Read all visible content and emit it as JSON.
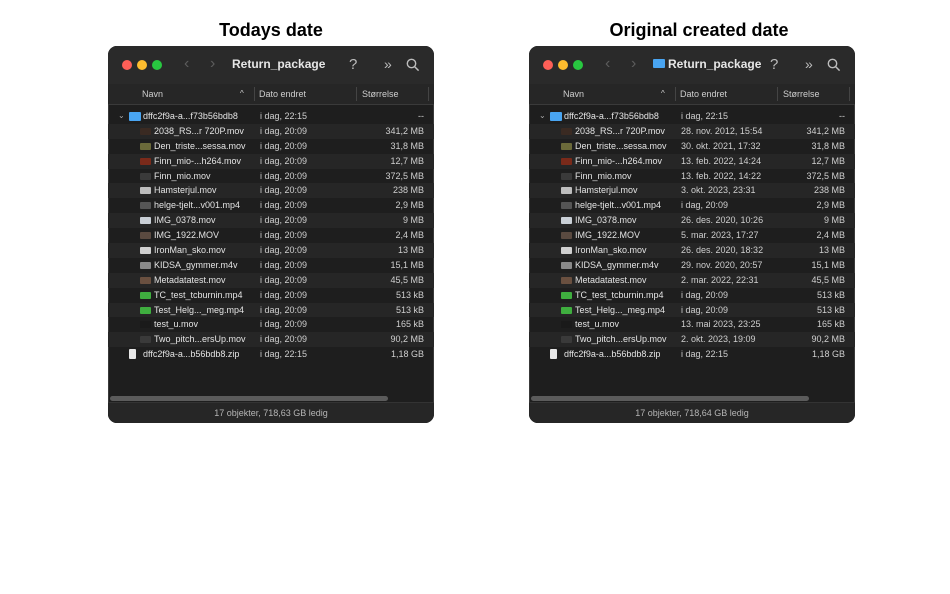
{
  "panels": [
    {
      "heading": "Todays date",
      "window": {
        "title": "Return_package",
        "columns": {
          "name": "Navn",
          "date": "Dato endret",
          "size": "Størrelse"
        },
        "rows": [
          {
            "name": "dffc2f9a-a...f73b56bdb8",
            "date": "i dag, 22:15",
            "size": "--"
          },
          {
            "name": "2038_RS...r 720P.mov",
            "date": "i dag, 20:09",
            "size": "341,2 MB"
          },
          {
            "name": "Den_triste...sessa.mov",
            "date": "i dag, 20:09",
            "size": "31,8 MB"
          },
          {
            "name": "Finn_mio-...h264.mov",
            "date": "i dag, 20:09",
            "size": "12,7 MB"
          },
          {
            "name": "Finn_mio.mov",
            "date": "i dag, 20:09",
            "size": "372,5 MB"
          },
          {
            "name": "Hamsterjul.mov",
            "date": "i dag, 20:09",
            "size": "238 MB"
          },
          {
            "name": "helge-tjelt...v001.mp4",
            "date": "i dag, 20:09",
            "size": "2,9 MB"
          },
          {
            "name": "IMG_0378.mov",
            "date": "i dag, 20:09",
            "size": "9 MB"
          },
          {
            "name": "IMG_1922.MOV",
            "date": "i dag, 20:09",
            "size": "2,4 MB"
          },
          {
            "name": "IronMan_sko.mov",
            "date": "i dag, 20:09",
            "size": "13 MB"
          },
          {
            "name": "KIDSA_gymmer.m4v",
            "date": "i dag, 20:09",
            "size": "15,1 MB"
          },
          {
            "name": "Metadatatest.mov",
            "date": "i dag, 20:09",
            "size": "45,5 MB"
          },
          {
            "name": "TC_test_tcburnin.mp4",
            "date": "i dag, 20:09",
            "size": "513 kB"
          },
          {
            "name": "Test_Helg..._meg.mp4",
            "date": "i dag, 20:09",
            "size": "513 kB"
          },
          {
            "name": "test_u.mov",
            "date": "i dag, 20:09",
            "size": "165 kB"
          },
          {
            "name": "Two_pitch...ersUp.mov",
            "date": "i dag, 20:09",
            "size": "90,2 MB"
          },
          {
            "name": "dffc2f9a-a...b56bdb8.zip",
            "date": "i dag, 22:15",
            "size": "1,18 GB"
          }
        ],
        "status": "17 objekter, 718,63 GB ledig"
      }
    },
    {
      "heading": "Original created date",
      "window": {
        "title": "Return_package",
        "columns": {
          "name": "Navn",
          "date": "Dato endret",
          "size": "Størrelse"
        },
        "rows": [
          {
            "name": "dffc2f9a-a...f73b56bdb8",
            "date": "i dag, 22:15",
            "size": "--"
          },
          {
            "name": "2038_RS...r 720P.mov",
            "date": "28. nov. 2012, 15:54",
            "size": "341,2 MB"
          },
          {
            "name": "Den_triste...sessa.mov",
            "date": "30. okt. 2021, 17:32",
            "size": "31,8 MB"
          },
          {
            "name": "Finn_mio-...h264.mov",
            "date": "13. feb. 2022, 14:24",
            "size": "12,7 MB"
          },
          {
            "name": "Finn_mio.mov",
            "date": "13. feb. 2022, 14:22",
            "size": "372,5 MB"
          },
          {
            "name": "Hamsterjul.mov",
            "date": "3. okt. 2023, 23:31",
            "size": "238 MB"
          },
          {
            "name": "helge-tjelt...v001.mp4",
            "date": "i dag, 20:09",
            "size": "2,9 MB"
          },
          {
            "name": "IMG_0378.mov",
            "date": "26. des. 2020, 10:26",
            "size": "9 MB"
          },
          {
            "name": "IMG_1922.MOV",
            "date": "5. mar. 2023, 17:27",
            "size": "2,4 MB"
          },
          {
            "name": "IronMan_sko.mov",
            "date": "26. des. 2020, 18:32",
            "size": "13 MB"
          },
          {
            "name": "KIDSA_gymmer.m4v",
            "date": "29. nov. 2020, 20:57",
            "size": "15,1 MB"
          },
          {
            "name": "Metadatatest.mov",
            "date": "2. mar. 2022, 22:31",
            "size": "45,5 MB"
          },
          {
            "name": "TC_test_tcburnin.mp4",
            "date": "i dag, 20:09",
            "size": "513 kB"
          },
          {
            "name": "Test_Helg..._meg.mp4",
            "date": "i dag, 20:09",
            "size": "513 kB"
          },
          {
            "name": "test_u.mov",
            "date": "13. mai 2023, 23:25",
            "size": "165 kB"
          },
          {
            "name": "Two_pitch...ersUp.mov",
            "date": "2. okt. 2023, 19:09",
            "size": "90,2 MB"
          },
          {
            "name": "dffc2f9a-a...b56bdb8.zip",
            "date": "i dag, 22:15",
            "size": "1,18 GB"
          }
        ],
        "status": "17 objekter, 718,64 GB ledig"
      }
    }
  ],
  "toolbar_icons": [
    "back-chevron-icon",
    "forward-chevron-icon",
    "help-icon",
    "more-chevrons-icon",
    "search-icon"
  ],
  "colors": {
    "window_bg": "#1e1e1e",
    "alt_row": "#262626",
    "folder": "#49a5f2",
    "close": "#fe5f57",
    "minimize": "#febc2e",
    "maximize": "#28c840"
  }
}
